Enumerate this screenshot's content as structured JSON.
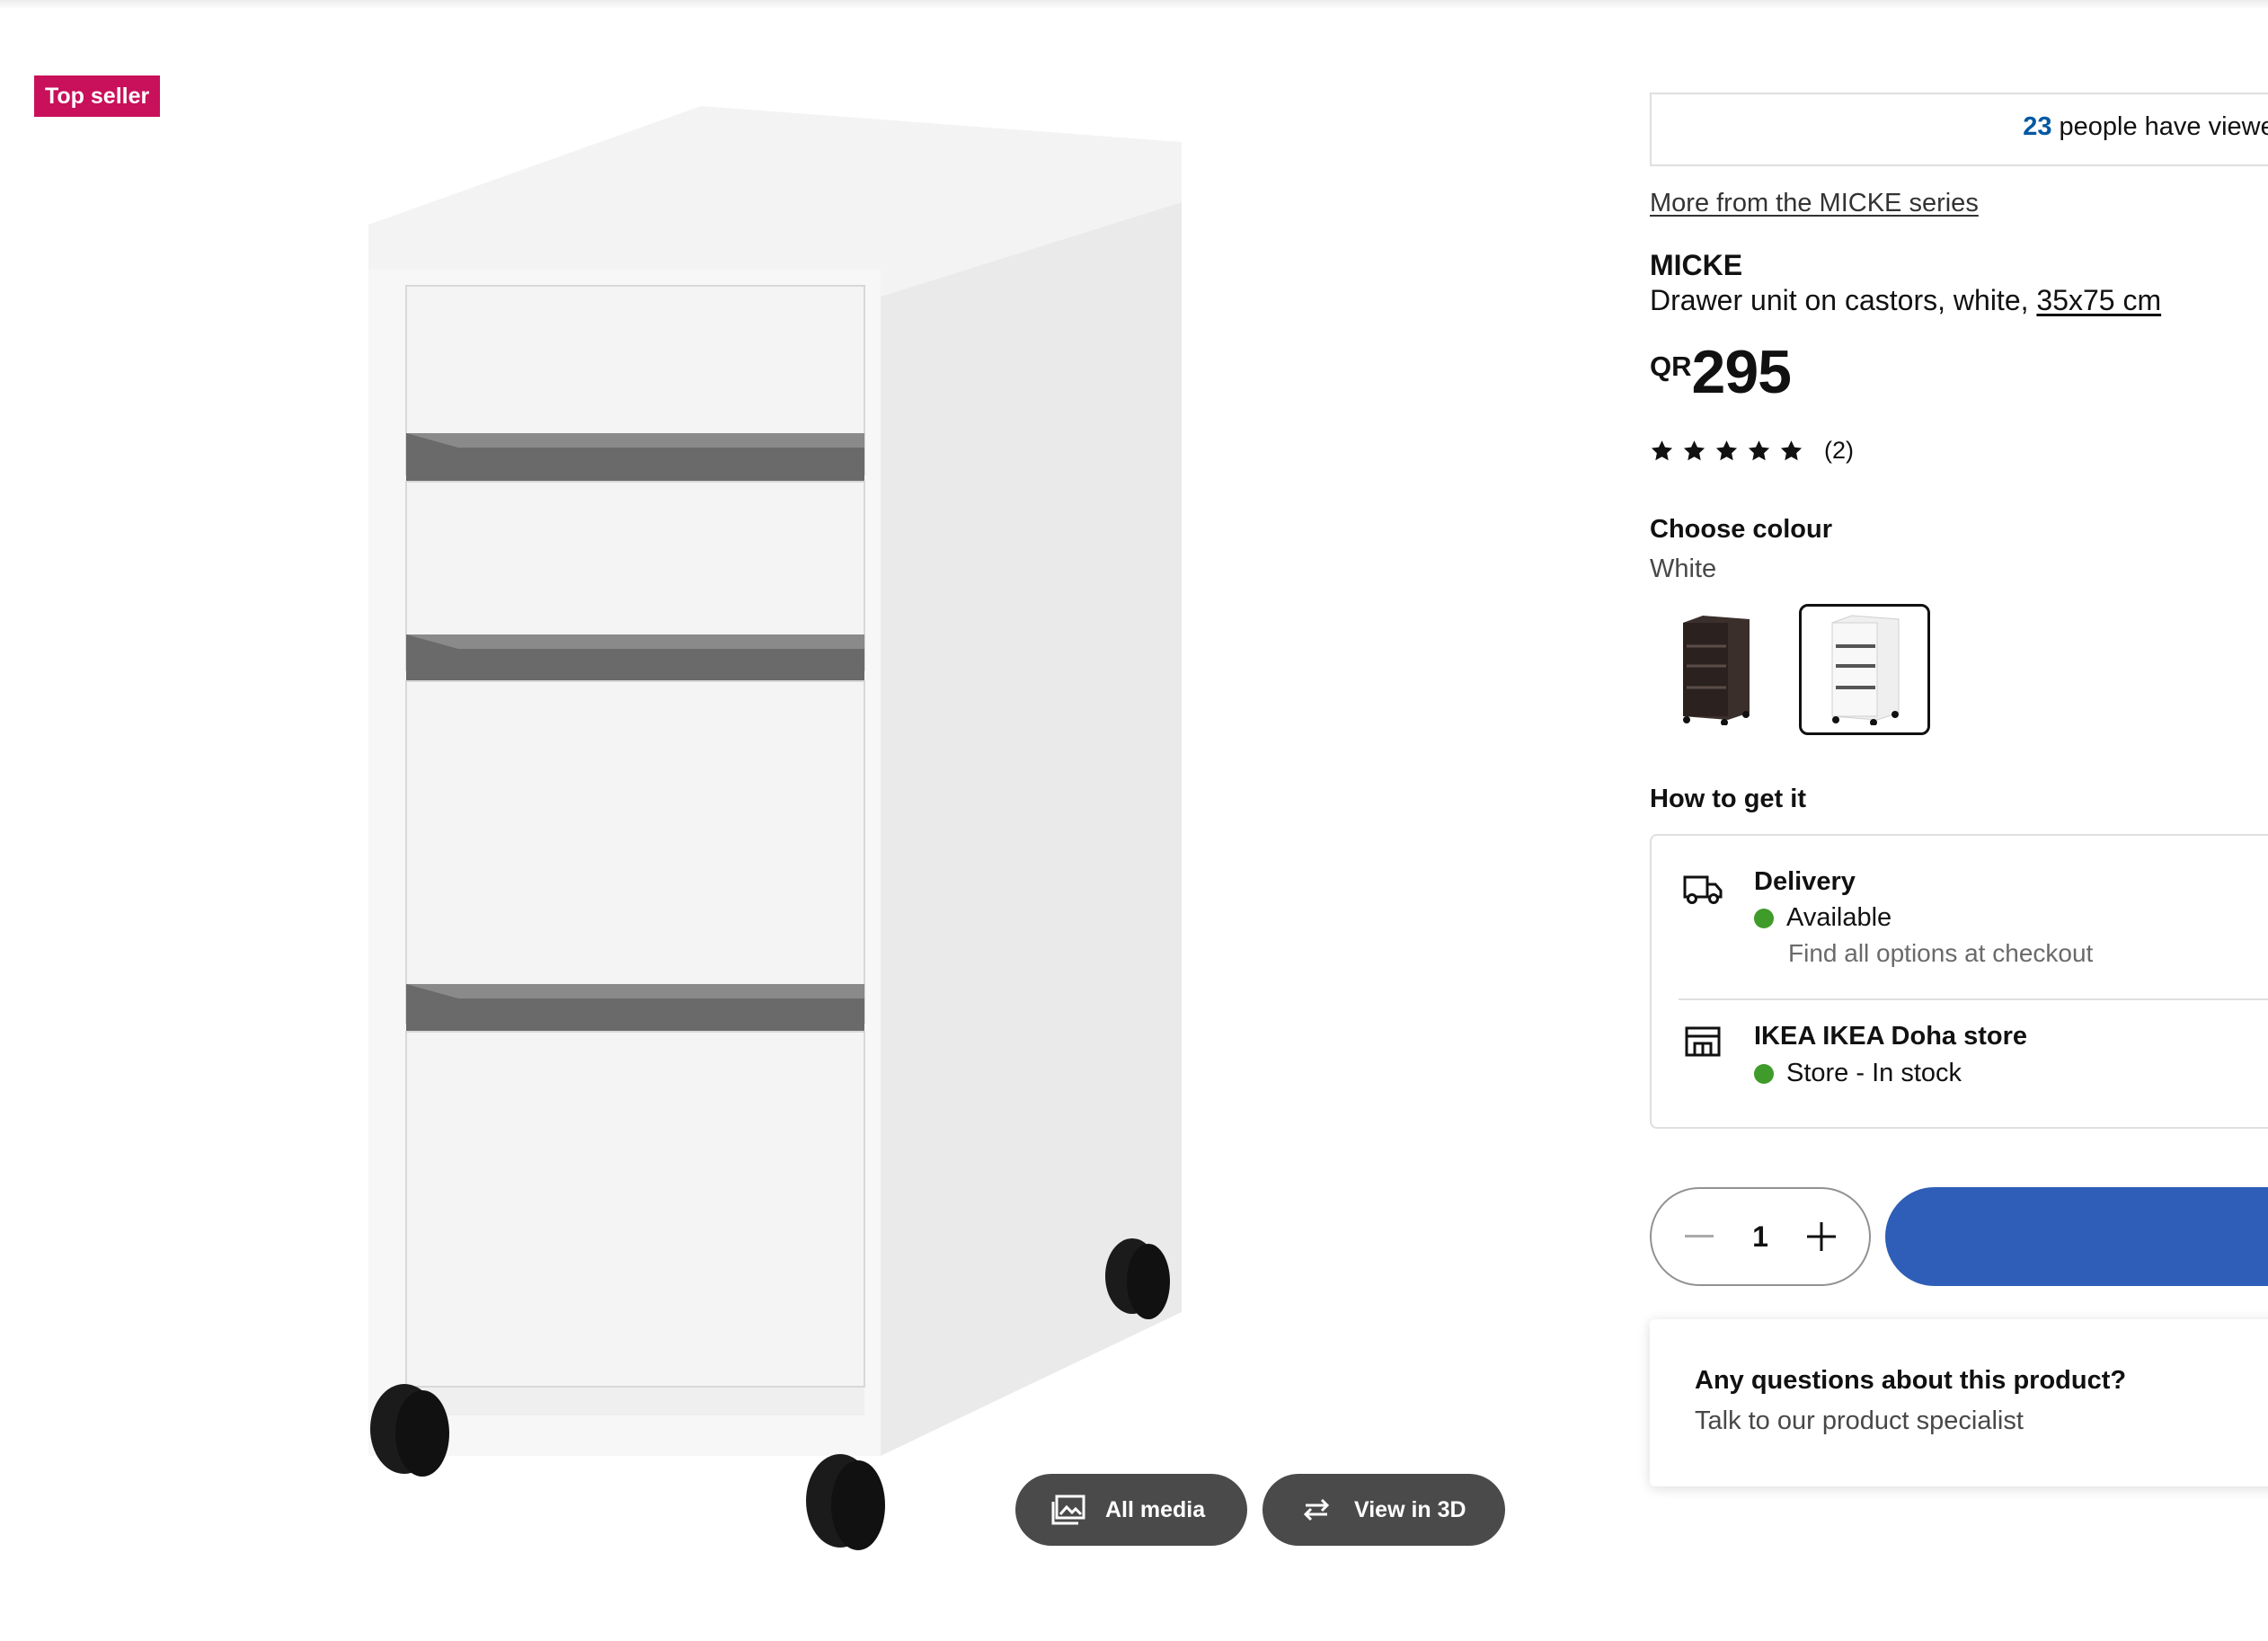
{
  "badge": {
    "label": "Top seller",
    "color": "#c9105a"
  },
  "media": {
    "all_media_label": "All media",
    "all_media_icon": "gallery-icon",
    "view_3d_label": "View in 3D",
    "view_3d_icon": "rotate-3d-icon"
  },
  "viewed": {
    "count": "23",
    "text": "people have viewed t"
  },
  "product": {
    "series_link": "More from the MICKE series",
    "name": "MICKE",
    "description": "Drawer unit on castors, white,",
    "dimensions_link": "35x75 cm",
    "currency": "QR",
    "price": "295",
    "rating_stars": 5,
    "rating_count": "(2)"
  },
  "colour": {
    "title": "Choose colour",
    "selected": "White",
    "options": [
      "black-brown-drawer-unit",
      "white-drawer-unit"
    ]
  },
  "how_to_get": {
    "title": "How to get it",
    "delivery": {
      "icon": "truck-icon",
      "title": "Delivery",
      "status": "Available",
      "note": "Find all options at checkout"
    },
    "store": {
      "icon": "store-icon",
      "title": "IKEA IKEA Doha store",
      "status": "Store - In stock"
    },
    "status_color": "#3f9b2a"
  },
  "quantity": {
    "value": "1"
  },
  "cart": {
    "color": "#2e5eb7"
  },
  "faq": {
    "title": "Any questions about this product?",
    "subtitle": "Talk to our product specialist"
  }
}
